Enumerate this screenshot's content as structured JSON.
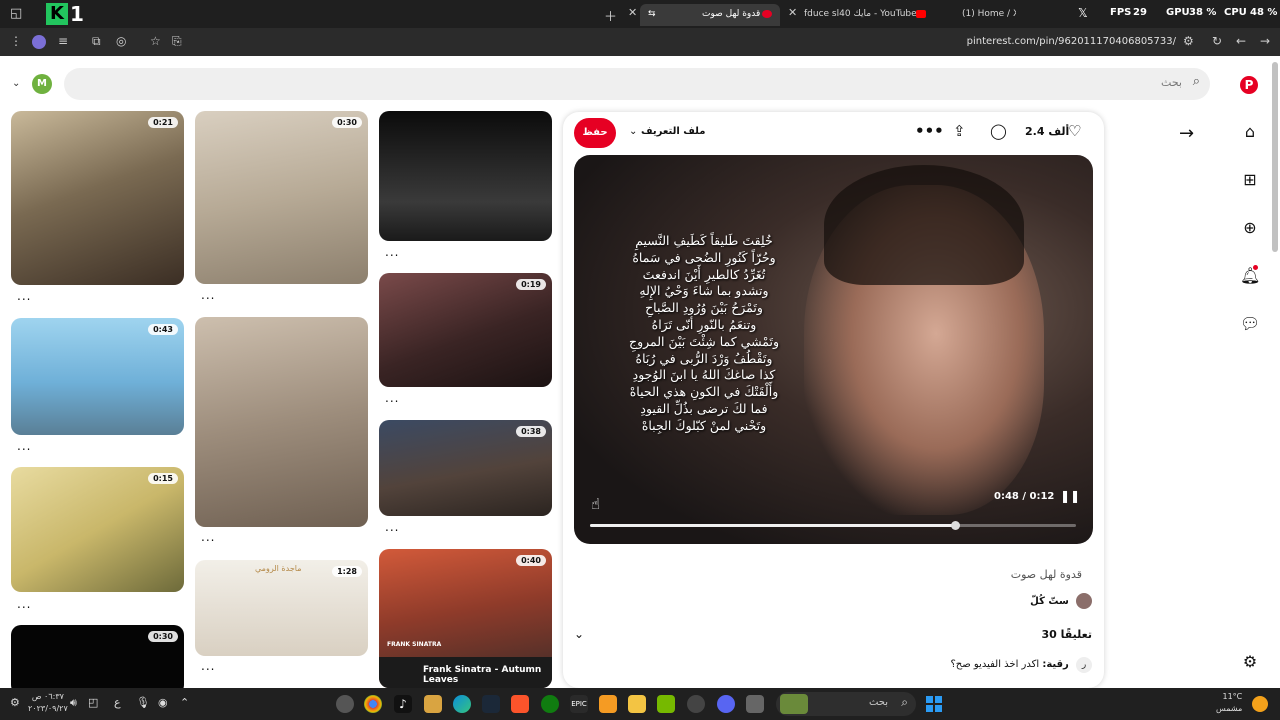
{
  "browser": {
    "tabs": [
      {
        "label": "قدوة لهل صوت",
        "active": true
      },
      {
        "label": "fduce sl40 مايك - YouTube",
        "active": false
      },
      {
        "label": "(1) Home / X",
        "active": false
      }
    ],
    "perf": {
      "fps_label": "FPS",
      "fps": "29",
      "gpu_label": "GPU",
      "gpu": "38 %",
      "cpu_label": "CPU",
      "cpu": "48 %"
    },
    "url": "pinterest.com/pin/962011170406805733/"
  },
  "page": {
    "search_placeholder": "بحث",
    "avatar_letter": "M"
  },
  "feed": {
    "durations": [
      "0:21",
      "0:30",
      "0:43",
      "0:19",
      "0:38",
      "0:15",
      "1:28",
      "0:40",
      "0:30"
    ],
    "more": "...",
    "caption_sinatra": "Frank Sinatra - Autumn Leaves",
    "caption_sinatra_small": "FRANK SINATRA",
    "caption_magda": "ماجدة الرومي"
  },
  "pin": {
    "save_label": "حفظ",
    "profile_label": "ملف التعريف",
    "likes": "2.4 ألف",
    "lyrics": [
      "خُلِقتَ طَليقاً كَطَيفِ النَّسيمِ",
      "وحُرّاً كَنُورِ الضُحى في سَماهُ",
      "تُغَرِّدُ كالطيرِ أَيْنَ اندفعتَ",
      "وتشدو بما شاءَ وَحْيُ الإِلهِ",
      "وتَمْرَحُ بَيْنَ وُرُودِ الصَّباحِ",
      "وتنعَمُ بالنّورِ أنّى تَرَاهُ",
      "وتَمْشي كما شِئْتَ بَيْنَ المروجِ",
      "وتَقْطُفُ وَرْدَ الرُّبى في رُبَاهُ",
      "كذا صاغكَ اللهُ يا ابنَ الوُجودِ",
      "وأَلْقَتْكَ في الكونِ هذي الحياهْ",
      "فما لكَ ترضى بذُلِّ القيودِ",
      "وتَحْني لمنْ كبّلوكَ الجِباهْ"
    ],
    "time_elapsed": "0:48",
    "time_total": "0:12",
    "progress": 0.75,
    "title": "قدوة لهل صوت",
    "creator": "ستّ كُلّ",
    "comments_count": "30 تعليقًا",
    "comment_author": "رقية:",
    "comment_text": "اكدر اخذ الفيديو صح؟",
    "comment_avatar": "ر"
  },
  "taskbar": {
    "search_label": "بحث",
    "clock_time": "٠٦:٣٧ ص",
    "clock_date": "٢٠٢٣/٠٩/٢٧",
    "lang": "ع",
    "weather_temp": "11°C",
    "weather_desc": "مشمس"
  },
  "colors": {
    "accent": "#e60023",
    "taskbar": "#202020",
    "titlebar": "#1f1f1f"
  }
}
